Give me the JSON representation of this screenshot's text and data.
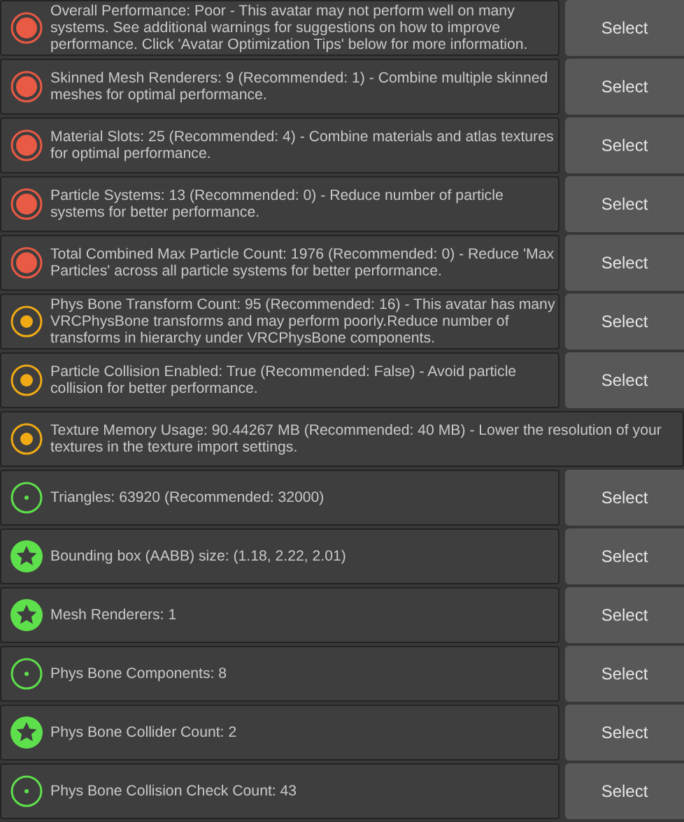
{
  "messages": [
    {
      "kind": "poor",
      "text": "Overall Performance: Poor - This avatar may not perform well on many systems. See additional warnings for suggestions on how to improve performance. Click 'Avatar Optimization Tips' below for more information.",
      "button": "Select"
    },
    {
      "kind": "poor",
      "text": "Skinned Mesh Renderers: 9 (Recommended: 1) - Combine multiple skinned meshes for optimal performance.",
      "button": "Select"
    },
    {
      "kind": "poor",
      "text": "Material Slots: 25 (Recommended: 4) - Combine materials and atlas textures for optimal performance.",
      "button": "Select"
    },
    {
      "kind": "poor",
      "text": "Particle Systems: 13 (Recommended: 0) - Reduce number of particle systems for better performance.",
      "button": "Select"
    },
    {
      "kind": "poor",
      "text": "Total Combined Max Particle Count: 1976 (Recommended: 0) - Reduce 'Max Particles' across all particle systems for better performance.",
      "button": "Select"
    },
    {
      "kind": "medium",
      "text": "Phys Bone Transform Count: 95 (Recommended: 16) - This avatar has many VRCPhysBone transforms and may perform poorly.Reduce number of transforms in hierarchy under VRCPhysBone components.",
      "button": "Select"
    },
    {
      "kind": "medium",
      "text": "Particle Collision Enabled: True (Recommended: False) - Avoid particle collision for better performance.",
      "button": "Select"
    },
    {
      "kind": "medium",
      "text": "Texture Memory Usage: 90.44267 MB (Recommended: 40 MB) - Lower the resolution of your textures in the texture import settings."
    },
    {
      "kind": "good",
      "text": "Triangles: 63920 (Recommended: 32000)",
      "button": "Select"
    },
    {
      "kind": "excellent",
      "text": "Bounding box (AABB) size: (1.18, 2.22, 2.01)",
      "button": "Select"
    },
    {
      "kind": "excellent",
      "text": "Mesh Renderers: 1",
      "button": "Select"
    },
    {
      "kind": "good",
      "text": "Phys Bone Components: 8",
      "button": "Select"
    },
    {
      "kind": "excellent",
      "text": "Phys Bone Collider Count: 2",
      "button": "Select"
    },
    {
      "kind": "good",
      "text": "Phys Bone Collision Check Count: 43",
      "button": "Select"
    }
  ]
}
